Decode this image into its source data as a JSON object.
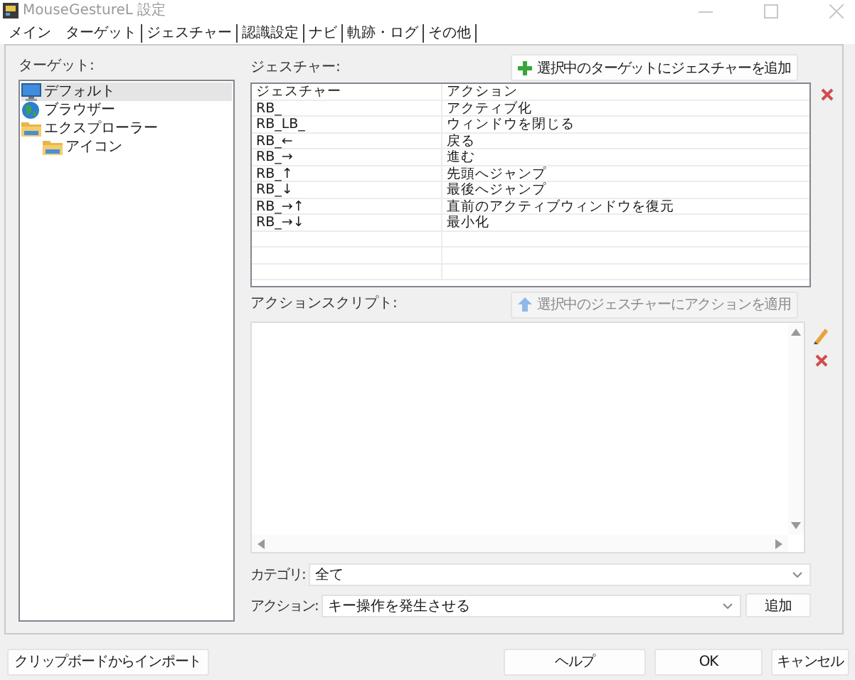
{
  "window": {
    "title": "MouseGestureL 設定"
  },
  "tabs": [
    {
      "label": "メイン",
      "selected": true
    },
    {
      "label": "ターゲット",
      "selected": false
    },
    {
      "label": "ジェスチャー",
      "selected": false
    },
    {
      "label": "認識設定",
      "selected": false
    },
    {
      "label": "ナビ",
      "selected": false
    },
    {
      "label": "軌跡・ログ",
      "selected": false
    },
    {
      "label": "その他",
      "selected": false
    }
  ],
  "targets": {
    "label": "ターゲット:",
    "tree": [
      {
        "label": "デフォルト",
        "kind": "monitor",
        "selected": true
      },
      {
        "label": "ブラウザー",
        "kind": "globe",
        "selected": false
      },
      {
        "label": "エクスプローラー",
        "kind": "folder",
        "selected": false,
        "children": [
          {
            "label": "アイコン",
            "kind": "folder",
            "selected": false
          }
        ]
      }
    ]
  },
  "gestures": {
    "label": "ジェスチャー:",
    "add_button": "選択中のターゲットにジェスチャーを追加",
    "columns": [
      "ジェスチャー",
      "アクション"
    ],
    "rows": [
      {
        "gesture": "RB_",
        "action": "アクティブ化"
      },
      {
        "gesture": "RB_LB_",
        "action": "ウィンドウを閉じる"
      },
      {
        "gesture": "RB_←",
        "action": "戻る"
      },
      {
        "gesture": "RB_→",
        "action": "進む"
      },
      {
        "gesture": "RB_↑",
        "action": "先頭へジャンプ"
      },
      {
        "gesture": "RB_↓",
        "action": "最後へジャンプ"
      },
      {
        "gesture": "RB_→↑",
        "action": "直前のアクティブウィンドウを復元"
      },
      {
        "gesture": "RB_→↓",
        "action": "最小化"
      }
    ]
  },
  "script": {
    "label": "アクションスクリプト:",
    "apply_button": {
      "label": "選択中のジェスチャーにアクションを適用",
      "disabled": true
    }
  },
  "category": {
    "label": "カテゴリ:",
    "value": "全て"
  },
  "action": {
    "label": "アクション:",
    "value": "キー操作を発生させる",
    "add_button": "追加"
  },
  "footer": {
    "import_button": "クリップボードからインポート",
    "buttons": [
      "ヘルプ",
      "OK",
      "キャンセル"
    ]
  }
}
